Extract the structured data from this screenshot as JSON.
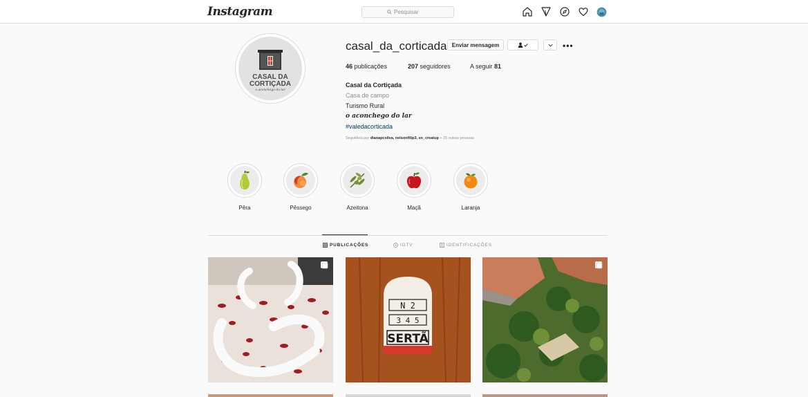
{
  "nav": {
    "logo": "Instagram",
    "search_placeholder": "Pesquisar",
    "icons": [
      "home-icon",
      "direct-icon",
      "explore-icon",
      "activity-heart-icon",
      "profile-avatar-icon"
    ]
  },
  "profile": {
    "username": "casal_da_corticada",
    "message_button": "Enviar mensagem",
    "following_icon": "person-check-icon",
    "dropdown_icon": "chevron-down-icon",
    "more_label": "•••",
    "avatar_text": {
      "line1": "CASAL DA",
      "line2": "CORTIÇADA",
      "line3": "o aconchego do lar"
    },
    "stats": {
      "posts_count": "46",
      "posts_label": "publicações",
      "followers_count": "207",
      "followers_label": "seguidores",
      "following_label": "A seguir",
      "following_count": "81"
    },
    "bio": {
      "name": "Casal da Cortiçada",
      "category": "Casa de campo",
      "line1": "Turismo Rural",
      "slogan": "o aconchego do lar",
      "hashtag": "#valedacorticada"
    },
    "followed_by": {
      "prefix": "Seguido/a por",
      "names": "dianapcsilva, nelsonfilip3, sn_creatup",
      "suffix": "+ 25 outras pessoas"
    }
  },
  "highlights": [
    {
      "label": "Pêra",
      "icon": "pear-icon"
    },
    {
      "label": "Pêssego",
      "icon": "peach-icon"
    },
    {
      "label": "Azeitona",
      "icon": "olive-icon"
    },
    {
      "label": "Maçã",
      "icon": "apple-icon"
    },
    {
      "label": "Laranja",
      "icon": "orange-icon"
    }
  ],
  "tabs": [
    {
      "label": "PUBLICAÇÕES",
      "icon": "grid-icon",
      "active": true
    },
    {
      "label": "IGTV",
      "icon": "igtv-icon",
      "active": false
    },
    {
      "label": "IDENTIFICAÇÕES",
      "icon": "tagged-icon",
      "active": false
    }
  ],
  "posts": [
    {
      "description": "towel swans with rose petals",
      "badge": "carousel-icon"
    },
    {
      "description": "road marker",
      "marker_line1": "N 2",
      "marker_line2": "3 4 5",
      "marker_line3": "SERTÃ"
    },
    {
      "description": "aerial view of house and garden",
      "badge": "carousel-icon"
    }
  ],
  "colors": {
    "background": "#fafafa",
    "border": "#dbdbdb",
    "text": "#262626",
    "muted": "#8e8e8e",
    "link": "#00376b"
  }
}
